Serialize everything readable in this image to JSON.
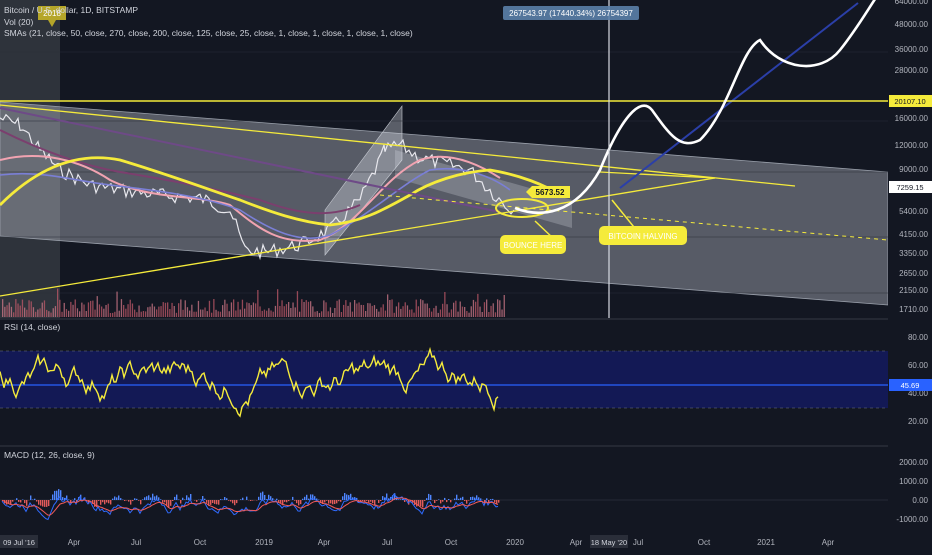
{
  "header": {
    "symbol_line": "Bitcoin / U.S. dollar, 1D, BITSTAMP",
    "vol_line": "Vol (20)",
    "sma_line": "SMAs (21, close, 50, close, 270, close, 200, close, 125, close, 25, close, 1, close, 1, close, 1, close, 1, close)",
    "year_badge": "2018",
    "measure_readout": "267543.97 (17440.34%) 26754397"
  },
  "annotations": {
    "price_tag": "5673.52",
    "bounce_label": "BOUNCE HERE",
    "halving_label": "BITCOIN HALVING"
  },
  "price_axis": {
    "ticks": [
      "64000.00",
      "48000.00",
      "36000.00",
      "28000.00",
      "16000.00",
      "12000.00",
      "9000.00",
      "5400.00",
      "4150.00",
      "3350.00",
      "2650.00",
      "2150.00",
      "1710.00"
    ],
    "level_label": "20107.10",
    "last_label": "7259.15"
  },
  "rsi": {
    "title": "RSI (14, close)",
    "ticks": [
      "80.00",
      "60.00",
      "40.00",
      "20.00"
    ],
    "value_label": "45.69"
  },
  "macd": {
    "title": "MACD (12, 26, close, 9)",
    "ticks": [
      "2000.00",
      "1000.00",
      "0.00",
      "-1000.00"
    ]
  },
  "time_axis": {
    "start_label": "09 Jul '16",
    "ticks": [
      "Apr",
      "Jul",
      "Oct",
      "2019",
      "Apr",
      "Jul",
      "Oct",
      "2020",
      "Apr",
      "Jul",
      "Oct",
      "2021",
      "Apr"
    ],
    "cursor_label": "18 May '20"
  },
  "colors": {
    "background": "#131722",
    "yellow": "#f5eb3b",
    "white": "#ffffff",
    "navy": "#1f2d8a",
    "rsi_band": "#141a5e",
    "measure_box": "#5b7fa8"
  },
  "chart_data": {
    "type": "line",
    "title": "",
    "y_scale": "log",
    "x": [
      "Jul '16",
      "Apr",
      "Jul",
      "Oct",
      "2019",
      "Apr",
      "Jul",
      "Oct",
      "2020",
      "Apr",
      "Jul",
      "Oct",
      "2021",
      "Apr"
    ],
    "series": [
      {
        "name": "",
        "values": [
          20000,
          15000,
          9000,
          7200,
          4000,
          3500,
          5400,
          12000,
          9000,
          7300,
          5673.52
        ]
      }
    ],
    "levels": {
      "horizontal": 20107.1,
      "last_price": 7259.15,
      "marked_price": 5673.52
    },
    "indicators": {
      "rsi_last": 45.69
    }
  }
}
